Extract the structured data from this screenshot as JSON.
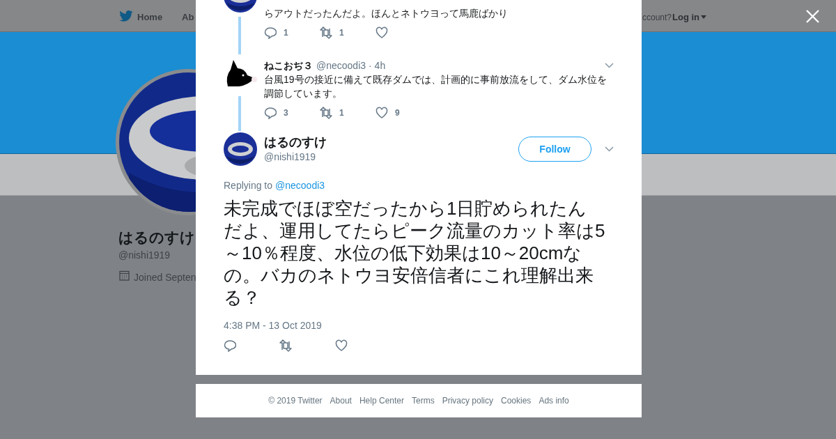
{
  "background_page": {
    "nav": [
      {
        "label": "Home"
      },
      {
        "label": "Ab"
      }
    ],
    "account_prompt": "ccount?",
    "login": "Log in",
    "profile": {
      "name": "はるのすけ",
      "handle": "@nishi1919",
      "joined": "Joined Septen"
    }
  },
  "thread": [
    {
      "kind": "cut",
      "text_lines": [
        "らアウトだったんだよ。ほんとネトウヨって馬鹿ばかり"
      ],
      "replies": "1",
      "retweets": "1"
    },
    {
      "kind": "full",
      "name": "ねこおぢ３",
      "handle": "@necoodi3",
      "time": "· 4h",
      "text_lines": [
        "台風19号の接近に備えて既存ダムでは、計画的に事前放流をして、ダム水位を",
        "調節しています。"
      ],
      "replies": "3",
      "retweets": "1",
      "likes": "9"
    }
  ],
  "tweet": {
    "name": "はるのすけ",
    "handle": "@nishi1919",
    "follow": "Follow",
    "replying_to": "Replying to",
    "mention": "@necoodi3",
    "text": "未完成でほぼ空だったから1日貯められたんだよ、運用してたらピーク流量のカット率は5～10％程度、水位の低下効果は10～20cmなの。バカのネトウヨ安倍信者にこれ理解出来る？",
    "timestamp": "4:38 PM - 13 Oct 2019"
  },
  "footer": [
    "© 2019 Twitter",
    "About",
    "Help Center",
    "Terms",
    "Privacy policy",
    "Cookies",
    "Ads info"
  ]
}
